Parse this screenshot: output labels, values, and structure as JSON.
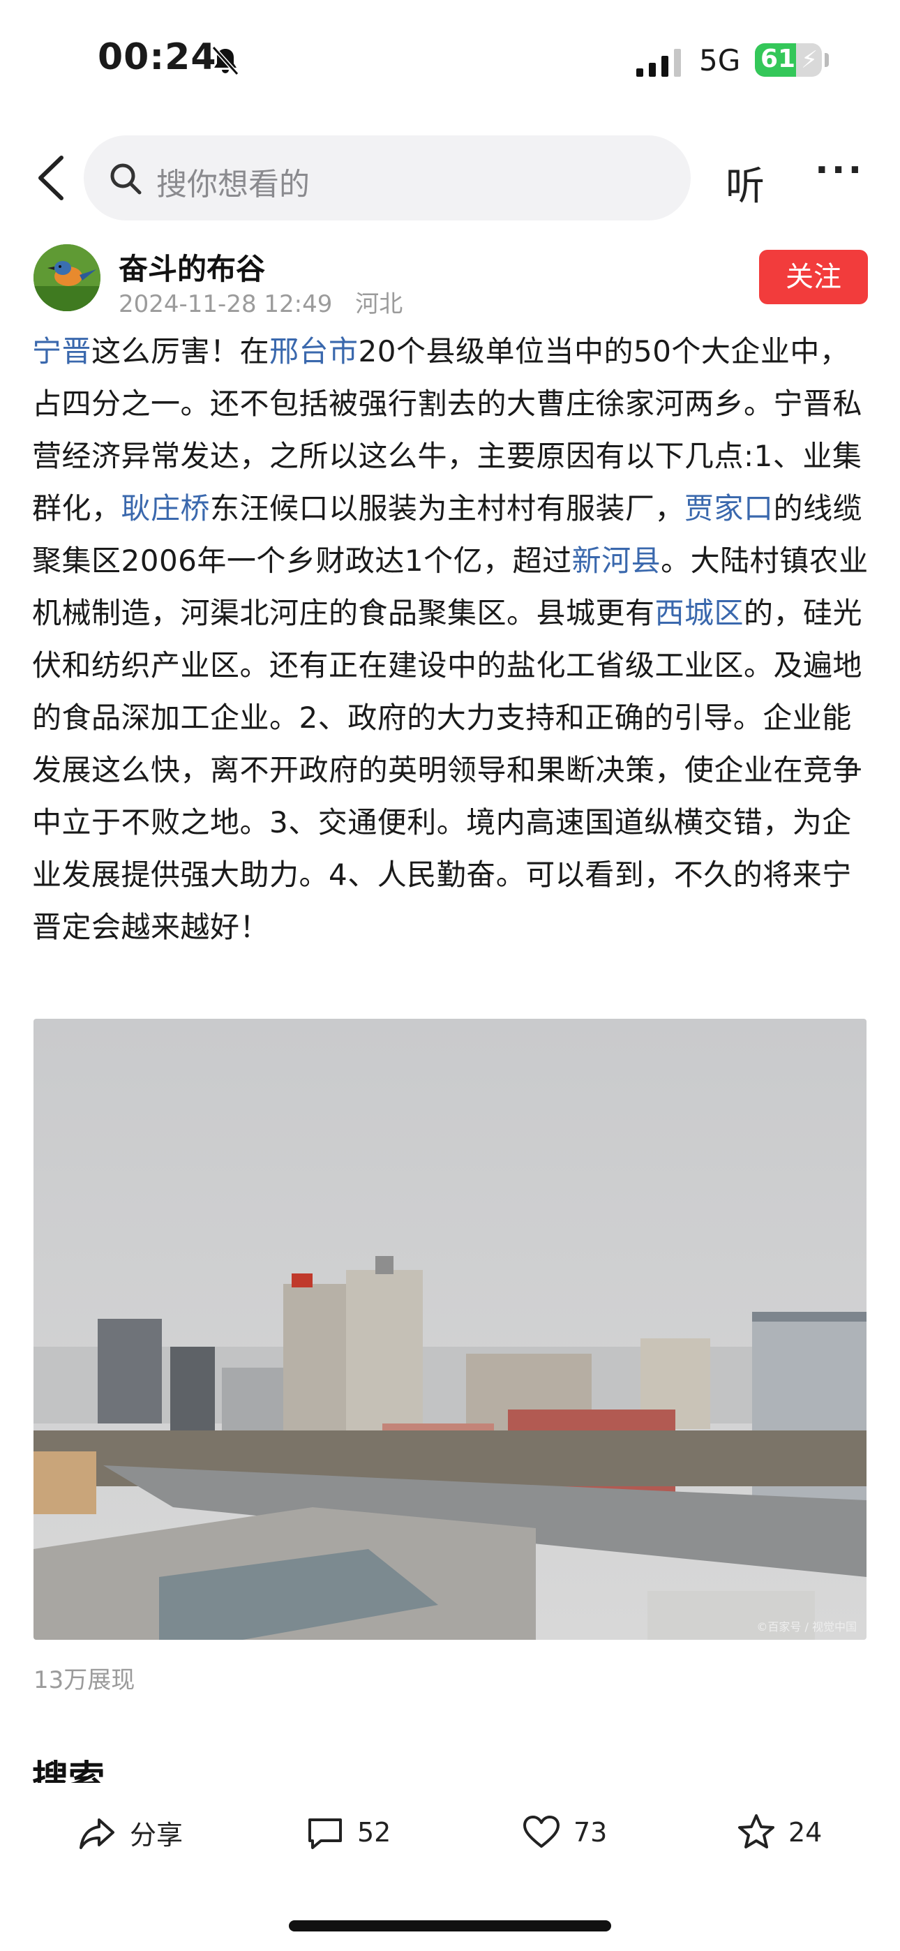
{
  "status_bar": {
    "time": "00:24",
    "network": "5G",
    "battery_level": "61",
    "battery_fraction": 0.61
  },
  "search": {
    "placeholder": "搜你想看的",
    "listen_label": "听",
    "more_label": "···"
  },
  "author": {
    "name": "奋斗的布谷",
    "date": "2024-11-28 12:49",
    "location": "河北",
    "follow_label": "关注"
  },
  "article": {
    "segments": [
      {
        "text": "宁晋",
        "link": true
      },
      {
        "text": "这么厉害！在",
        "link": false
      },
      {
        "text": "邢台市",
        "link": true
      },
      {
        "text": "20个县级单位当中的50个大企业中，占四分之一。还不包括被强行割去的大曹庄徐家河两乡。宁晋私营经济异常发达，之所以这么牛，主要原因有以下几点:1、业集群化，",
        "link": false
      },
      {
        "text": "耿庄桥",
        "link": true
      },
      {
        "text": "东汪候口以服装为主村村有服装厂，",
        "link": false
      },
      {
        "text": "贾家口",
        "link": true
      },
      {
        "text": "的线缆聚集区2006年一个乡财政达1个亿，超过",
        "link": false
      },
      {
        "text": "新河县",
        "link": true
      },
      {
        "text": "。大陆村镇农业机械制造，河渠北河庄的食品聚集区。县城更有",
        "link": false
      },
      {
        "text": "西城区",
        "link": true
      },
      {
        "text": "的，硅光伏和纺织产业区。还有正在建设中的盐化工省级工业区。及遍地的食品深加工企业。2、政府的大力支持和正确的引导。企业能发展这么快，离不开政府的英明领导和果断决策，使企业在竞争中立于不败之地。3、交通便利。境内高速国道纵横交错，为企业发展提供强大助力。4、人民勤奋。可以看到，不久的将来宁晋定会越来越好！",
        "link": false
      }
    ]
  },
  "photo": {
    "watermark": "©百家号 / 视觉中国"
  },
  "views": "13万展现",
  "section_peek": "搜索",
  "actions": {
    "share": "分享",
    "comments": "52",
    "likes": "73",
    "favorites": "24"
  },
  "colors": {
    "link": "#3a68ad",
    "follow_bg": "#f23c3c",
    "battery": "#34c759"
  }
}
